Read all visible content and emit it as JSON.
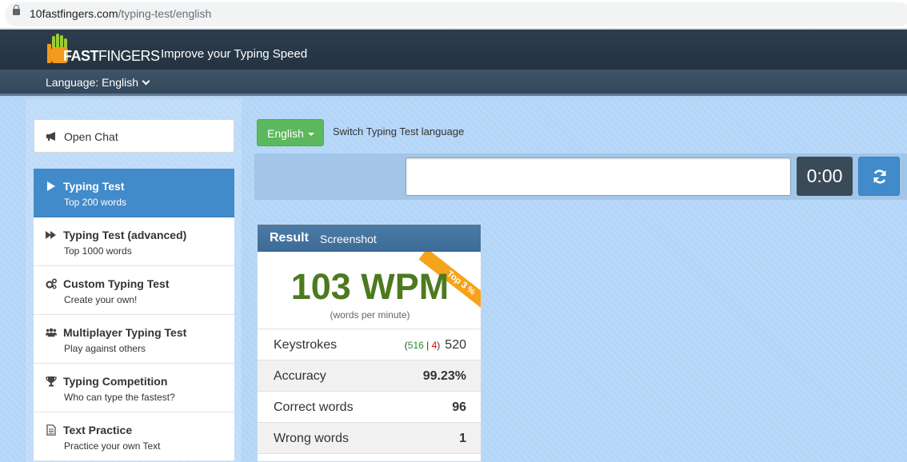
{
  "browser": {
    "url_domain": "10fastfingers.com",
    "url_path": "/typing-test/english"
  },
  "header": {
    "logo_bold": "FAST",
    "logo_thin": "FINGERS",
    "tagline": "Improve your Typing Speed",
    "language_menu": "Language: English"
  },
  "sidebar": {
    "open_chat": "Open Chat",
    "items": [
      {
        "title": "Typing Test",
        "sub": "Top 200 words",
        "icon": "play-icon"
      },
      {
        "title": "Typing Test (advanced)",
        "sub": "Top 1000 words",
        "icon": "fast-forward-icon"
      },
      {
        "title": "Custom Typing Test",
        "sub": "Create your own!",
        "icon": "gears-icon"
      },
      {
        "title": "Multiplayer Typing Test",
        "sub": "Play against others",
        "icon": "users-icon"
      },
      {
        "title": "Typing Competition",
        "sub": "Who can type the fastest?",
        "icon": "trophy-icon"
      },
      {
        "title": "Text Practice",
        "sub": "Practice your own Text",
        "icon": "document-icon"
      }
    ]
  },
  "test": {
    "language_button": "English",
    "switch_label": "Switch Typing Test language",
    "input_value": "",
    "timer": "0:00"
  },
  "result": {
    "title": "Result",
    "screenshot": "Screenshot",
    "ribbon": "Top 3 %",
    "wpm": "103 WPM",
    "wpm_sub": "(words per minute)",
    "keystrokes": {
      "label": "Keystrokes",
      "open": "(",
      "correct": "516",
      "sep": " | ",
      "wrong": "4",
      "close": ")",
      "total": "520"
    },
    "accuracy": {
      "label": "Accuracy",
      "value": "99.23%"
    },
    "correct_words": {
      "label": "Correct words",
      "value": "96"
    },
    "wrong_words": {
      "label": "Wrong words",
      "value": "1"
    }
  },
  "colors": {
    "accent_blue": "#428bca",
    "green_button": "#5cb85c",
    "wpm_green": "#4c7a1f",
    "ribbon_orange": "#f5a31a"
  }
}
